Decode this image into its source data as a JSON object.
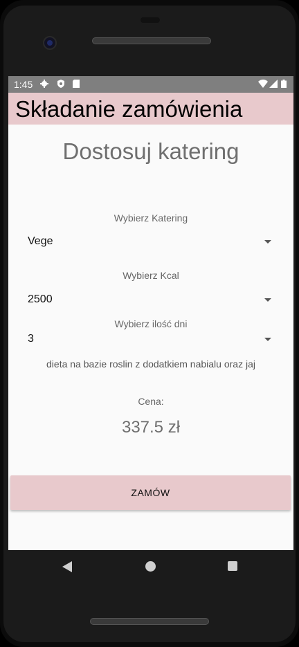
{
  "status_bar": {
    "time": "1:45"
  },
  "app_bar": {
    "title": "Składanie zamówienia"
  },
  "main": {
    "heading": "Dostosuj katering",
    "catering": {
      "label": "Wybierz Katering",
      "value": "Vege"
    },
    "kcal": {
      "label": "Wybierz Kcal",
      "value": "2500"
    },
    "days": {
      "label": "Wybierz ilość dni",
      "value": "3"
    },
    "description": "dieta na bazie roslin z dodatkiem nabialu oraz jaj",
    "price_label": "Cena:",
    "price_value": "337.5 zł",
    "order_button": "ZAMÓW"
  },
  "colors": {
    "accent": "#e8c9cc",
    "status_bar": "#7f7f7f"
  },
  "icons": [
    "gear-icon",
    "shield-icon",
    "sd-card-icon",
    "wifi-icon",
    "signal-icon",
    "battery-icon",
    "back-icon",
    "home-icon",
    "recents-icon"
  ]
}
